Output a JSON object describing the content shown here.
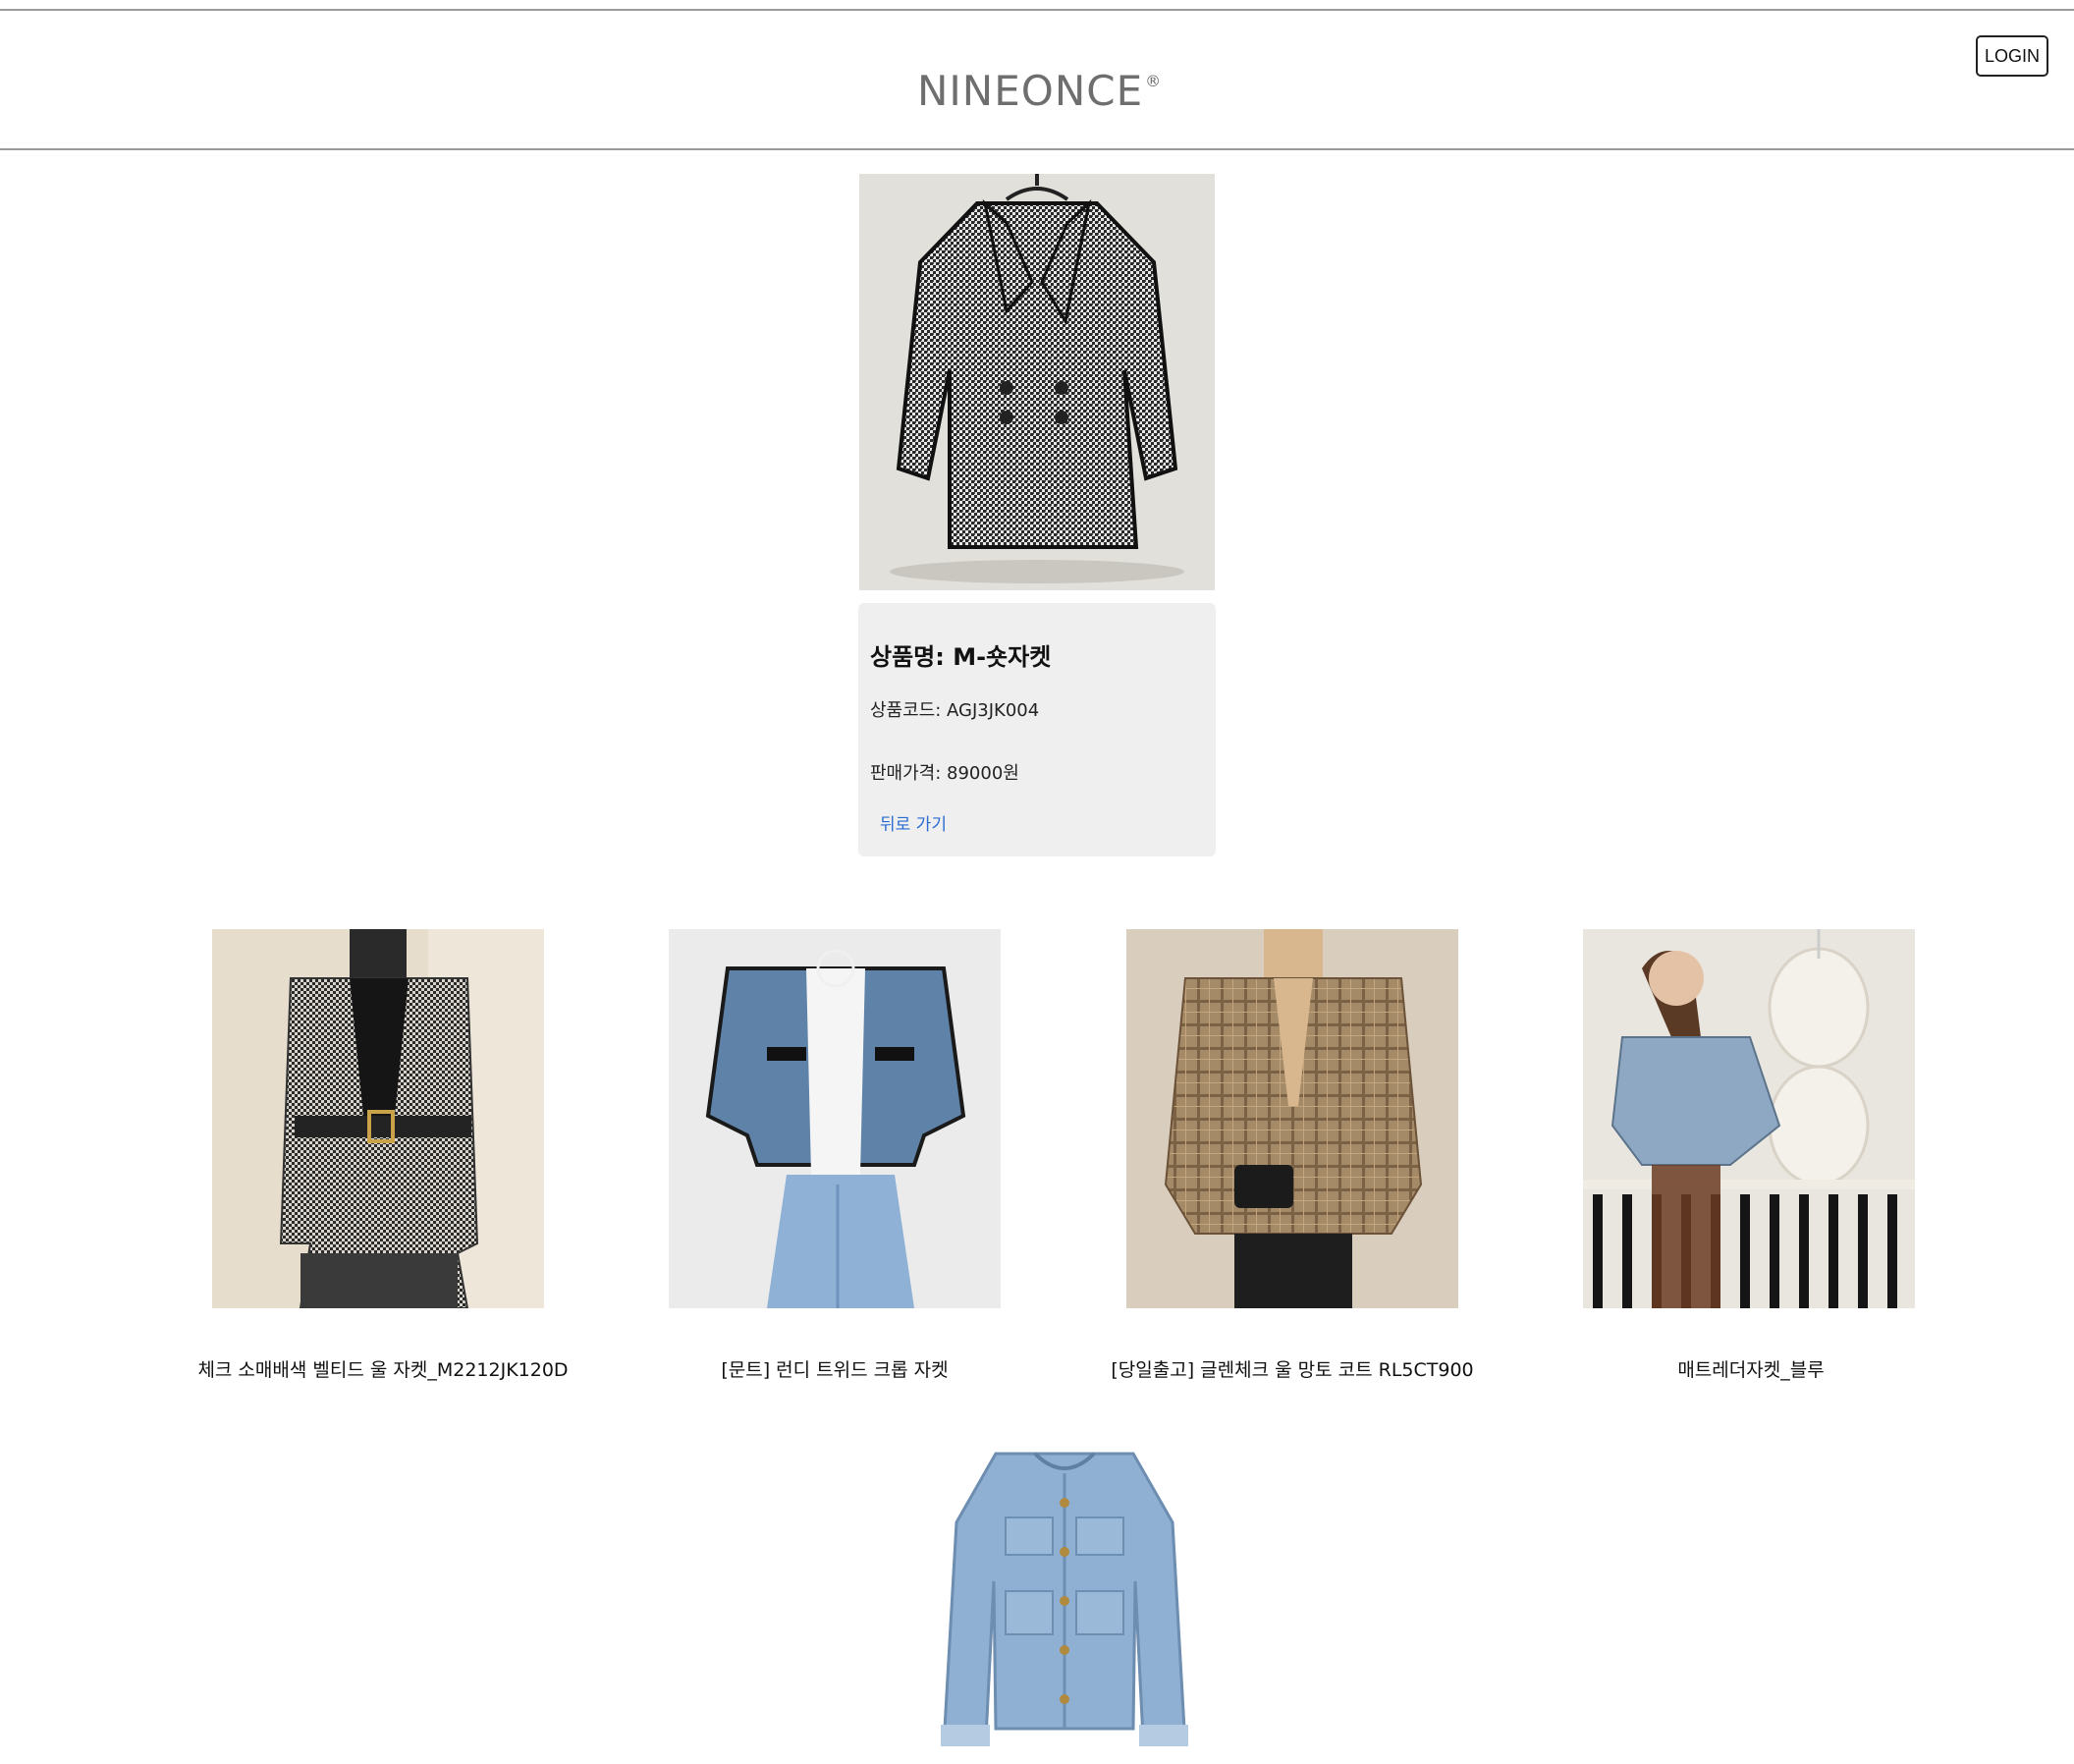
{
  "header": {
    "logo_text": "NINEONCE",
    "logo_mark": "®",
    "login_label": "LOGIN"
  },
  "product": {
    "image_alt": "houndstooth knit jacket",
    "title": "상품명: M-숏자켓",
    "code": "상품코드: AGJ3JK004",
    "price": "판매가격: 89000원",
    "back_label": "뒤로 가기"
  },
  "related": [
    {
      "name": "체크 소매배색 벨티드 울 자켓_M2212JK120D"
    },
    {
      "name": "[문트] 런디 트위드 크롭 자켓"
    },
    {
      "name": "[당일출고] 글렌체크 울 망토 코트 RL5CT900"
    },
    {
      "name": "매트레더자켓_블루"
    }
  ],
  "colors": {
    "link": "#2a6bd1",
    "card_bg": "#efefef",
    "logo": "#6e6e6e"
  }
}
